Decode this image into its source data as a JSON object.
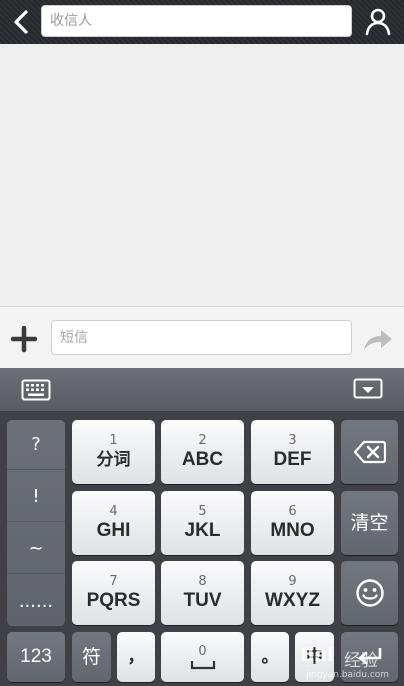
{
  "header": {
    "recipient_placeholder": "收信人"
  },
  "compose": {
    "sms_placeholder": "短信"
  },
  "keyboard": {
    "symbols": [
      "?",
      "!",
      "~",
      "......"
    ],
    "keys": [
      {
        "num": "1",
        "label": "分词"
      },
      {
        "num": "2",
        "label": "ABC"
      },
      {
        "num": "3",
        "label": "DEF"
      },
      {
        "num": "4",
        "label": "GHI"
      },
      {
        "num": "5",
        "label": "JKL"
      },
      {
        "num": "6",
        "label": "MNO"
      },
      {
        "num": "7",
        "label": "PQRS"
      },
      {
        "num": "8",
        "label": "TUV"
      },
      {
        "num": "9",
        "label": "WXYZ"
      }
    ],
    "clear_label": "清空",
    "bottom": {
      "num_label": "123",
      "sym_label": "符",
      "comma_label": "，",
      "space_num": "0",
      "period_label": "。",
      "lang_label": "中"
    }
  },
  "watermark": {
    "logo": "Bai",
    "text": "经验",
    "url": "jingyan.baidu.com"
  },
  "colors": {
    "keyboard_bg": "#3f4146",
    "light_key": "#eceef1",
    "dark_key": "#6a6e75",
    "topbar": "#2b2d31"
  }
}
